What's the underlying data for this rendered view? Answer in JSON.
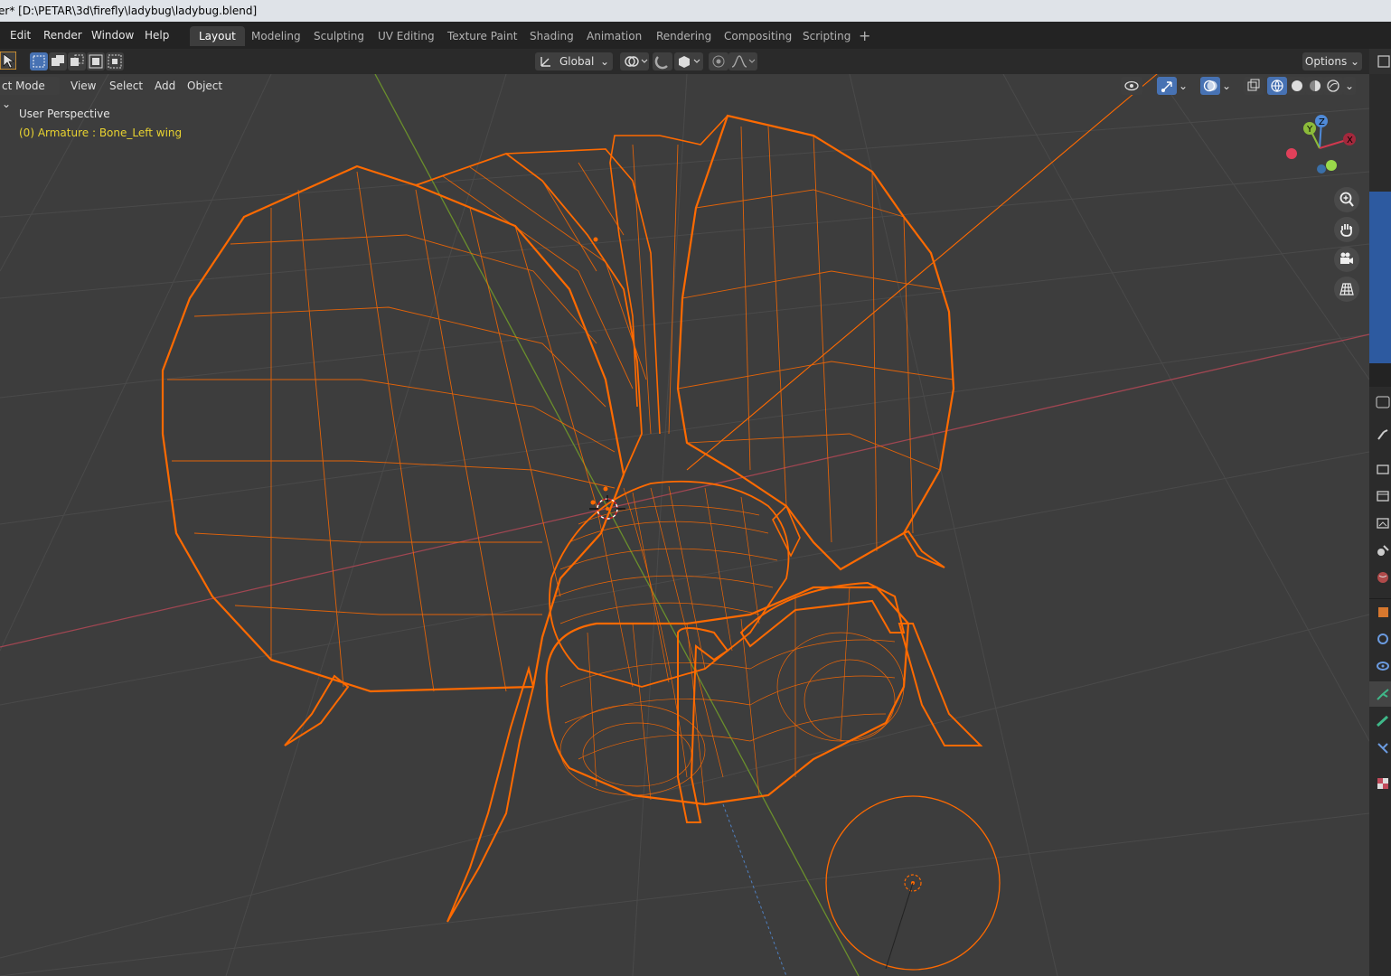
{
  "window": {
    "title": "er* [D:\\PETAR\\3d\\firefly\\ladybug\\ladybug.blend]"
  },
  "menu": {
    "edit": "Edit",
    "render": "Render",
    "window": "Window",
    "help": "Help"
  },
  "workspaces": [
    "Layout",
    "Modeling",
    "Sculpting",
    "UV Editing",
    "Texture Paint",
    "Shading",
    "Animation",
    "Rendering",
    "Compositing",
    "Scripting"
  ],
  "toolbar": {
    "orientation": "Global",
    "options": "Options"
  },
  "header": {
    "mode": "ct Mode",
    "view": "View",
    "select": "Select",
    "add": "Add",
    "object": "Object"
  },
  "viewport": {
    "perspective": "User Perspective",
    "active_info": "(0) Armature : Bone_Left wing"
  },
  "gizmo": {
    "x": "X",
    "y": "Y",
    "z": "Z"
  },
  "colors": {
    "wire": "#ff6a00",
    "accent": "#4772b3",
    "info_yellow": "#e8d230"
  }
}
